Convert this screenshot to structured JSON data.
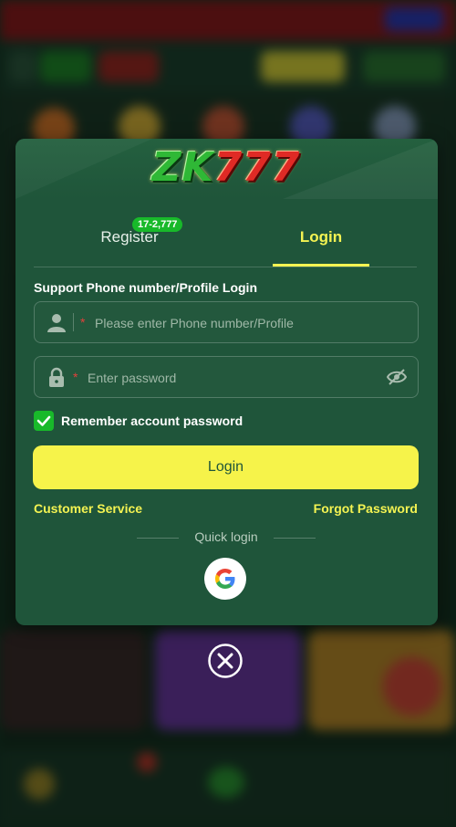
{
  "logo": {
    "part1": "ZK",
    "part2": "777"
  },
  "tabs": {
    "register_label": "Register",
    "register_badge": "17-2,777",
    "login_label": "Login"
  },
  "form": {
    "support_label": "Support Phone number/Profile Login",
    "phone_placeholder": "Please enter Phone number/Profile",
    "password_placeholder": "Enter password",
    "required_mark": "*",
    "remember_label": "Remember account password",
    "remember_checked": true
  },
  "actions": {
    "login_button": "Login",
    "customer_service": "Customer Service",
    "forgot_password": "Forgot Password",
    "quick_login": "Quick login"
  },
  "icons": {
    "user": "user-icon",
    "lock": "lock-icon",
    "eye_off": "eye-off-icon",
    "check": "check-icon",
    "google": "google-icon",
    "close": "close-icon"
  },
  "colors": {
    "modal_bg": "#1f553a",
    "accent_yellow": "#f4f352",
    "badge_green": "#18b92a",
    "required_red": "#e0413b"
  }
}
